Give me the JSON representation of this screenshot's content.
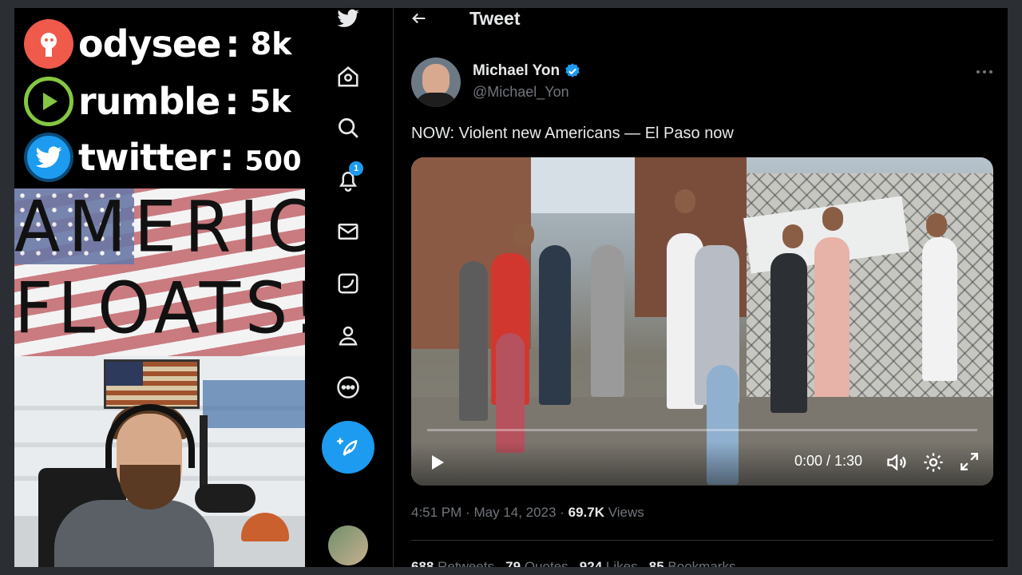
{
  "overlay": {
    "stats": [
      {
        "platform": "odysee",
        "count": "8k",
        "color": "#ef5a4b"
      },
      {
        "platform": "rumble",
        "count": "5k",
        "color": "#85c742"
      },
      {
        "platform": "twitter",
        "count": "500",
        "color": "#1d9bf0"
      }
    ],
    "banner": {
      "line1": "AMERICA",
      "line2": "FLOATS!"
    }
  },
  "nav": {
    "items": [
      {
        "name": "home",
        "icon": "home-icon"
      },
      {
        "name": "explore",
        "icon": "search-icon"
      },
      {
        "name": "notifications",
        "icon": "bell-icon",
        "badge": "1"
      },
      {
        "name": "messages",
        "icon": "mail-icon"
      },
      {
        "name": "twitter-blue",
        "icon": "blue-bird-icon"
      },
      {
        "name": "profile",
        "icon": "person-icon"
      },
      {
        "name": "more",
        "icon": "more-circle-icon"
      }
    ],
    "accent": "#1d9bf0"
  },
  "header": {
    "title": "Tweet"
  },
  "tweet": {
    "author_name": "Michael Yon",
    "author_handle": "@Michael_Yon",
    "text": "NOW: Violent new Americans — El Paso now",
    "video": {
      "time": "0:00 / 1:30"
    },
    "meta": {
      "time": "4:51 PM",
      "date": "May 14, 2023",
      "views_count": "69.7K",
      "views_label": "Views",
      "separator": "·"
    },
    "stats": [
      {
        "count": "688",
        "label": "Retweets"
      },
      {
        "count": "79",
        "label": "Quotes"
      },
      {
        "count": "924",
        "label": "Likes"
      },
      {
        "count": "85",
        "label": "Bookmarks"
      }
    ]
  }
}
